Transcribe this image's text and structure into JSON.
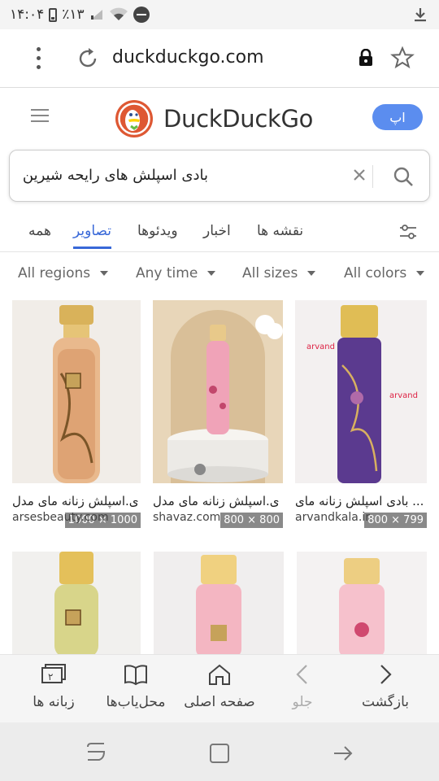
{
  "status": {
    "time": "۱۴:۰۴",
    "battery": "٪۱۳"
  },
  "browser": {
    "url": "duckduckgo.com"
  },
  "ddg": {
    "logo_text": "DuckDuckGo",
    "app_button": "اپ"
  },
  "search": {
    "query": "بادی اسپلش های رایحه شیرین"
  },
  "tabs": {
    "all": "همه",
    "images": "تصاویر",
    "videos": "ویدئوها",
    "news": "اخبار",
    "maps": "نقشه ها"
  },
  "filters": {
    "regions": "All regions",
    "time": "Any time",
    "sizes": "All sizes",
    "colors": "All colors"
  },
  "results": [
    {
      "title": "ی.اسپلش زنانه مای مدل",
      "source": "arsesbeauty.com",
      "dims": "1000 × 1000"
    },
    {
      "title": "ی.اسپلش زنانه مای مدل",
      "source": "shavaz.com",
      "dims": "800 × 800"
    },
    {
      "title": "... بادی اسپلش زنانه مای",
      "source": "arvandkala.ir",
      "dims": "800 × 799"
    }
  ],
  "bottom_nav": {
    "back": "بازگشت",
    "forward": "جلو",
    "home": "صفحه اصلی",
    "bookmarks": "محل‌یاب‌ها",
    "tabs": "زبانه ها",
    "tab_count": "۲"
  }
}
